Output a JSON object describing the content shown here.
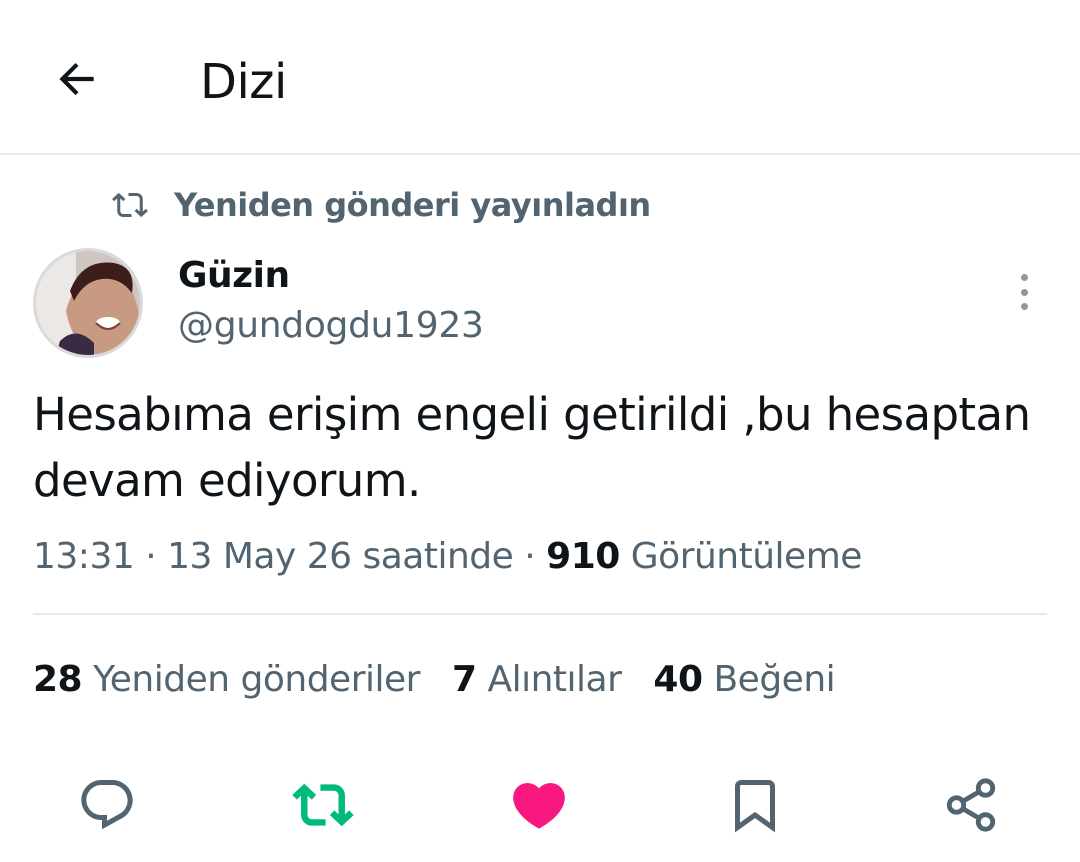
{
  "header": {
    "title": "Dizi",
    "back_icon": "arrow-left-icon"
  },
  "repost_banner": {
    "text": "Yeniden gönderi yayınladın",
    "icon": "repost-icon"
  },
  "tweet": {
    "author": {
      "name": "Güzin",
      "handle": "@gundogdu1923"
    },
    "text": "Hesabıma erişim engeli getirildi ,bu hesaptan devam ediyorum.",
    "time": "13:31",
    "date": "13 May 26 saatinde",
    "separator": "·",
    "views_count": "910",
    "views_label": "Görüntüleme"
  },
  "stats": {
    "reposts_count": "28",
    "reposts_label": "Yeniden gönderiler",
    "quotes_count": "7",
    "quotes_label": "Alıntılar",
    "likes_count": "40",
    "likes_label": "Beğeni"
  },
  "actions": [
    {
      "name": "reply",
      "icon": "reply-icon",
      "active": false
    },
    {
      "name": "repost",
      "icon": "repost-icon",
      "active": true
    },
    {
      "name": "like",
      "icon": "heart-icon",
      "active": true
    },
    {
      "name": "bookmark",
      "icon": "bookmark-icon",
      "active": false
    },
    {
      "name": "share",
      "icon": "share-icon",
      "active": false
    }
  ],
  "colors": {
    "text": "#0f1419",
    "secondary": "#536471",
    "repost_active": "#00ba7c",
    "like_active": "#f91880",
    "divider": "#e7e9eb"
  }
}
